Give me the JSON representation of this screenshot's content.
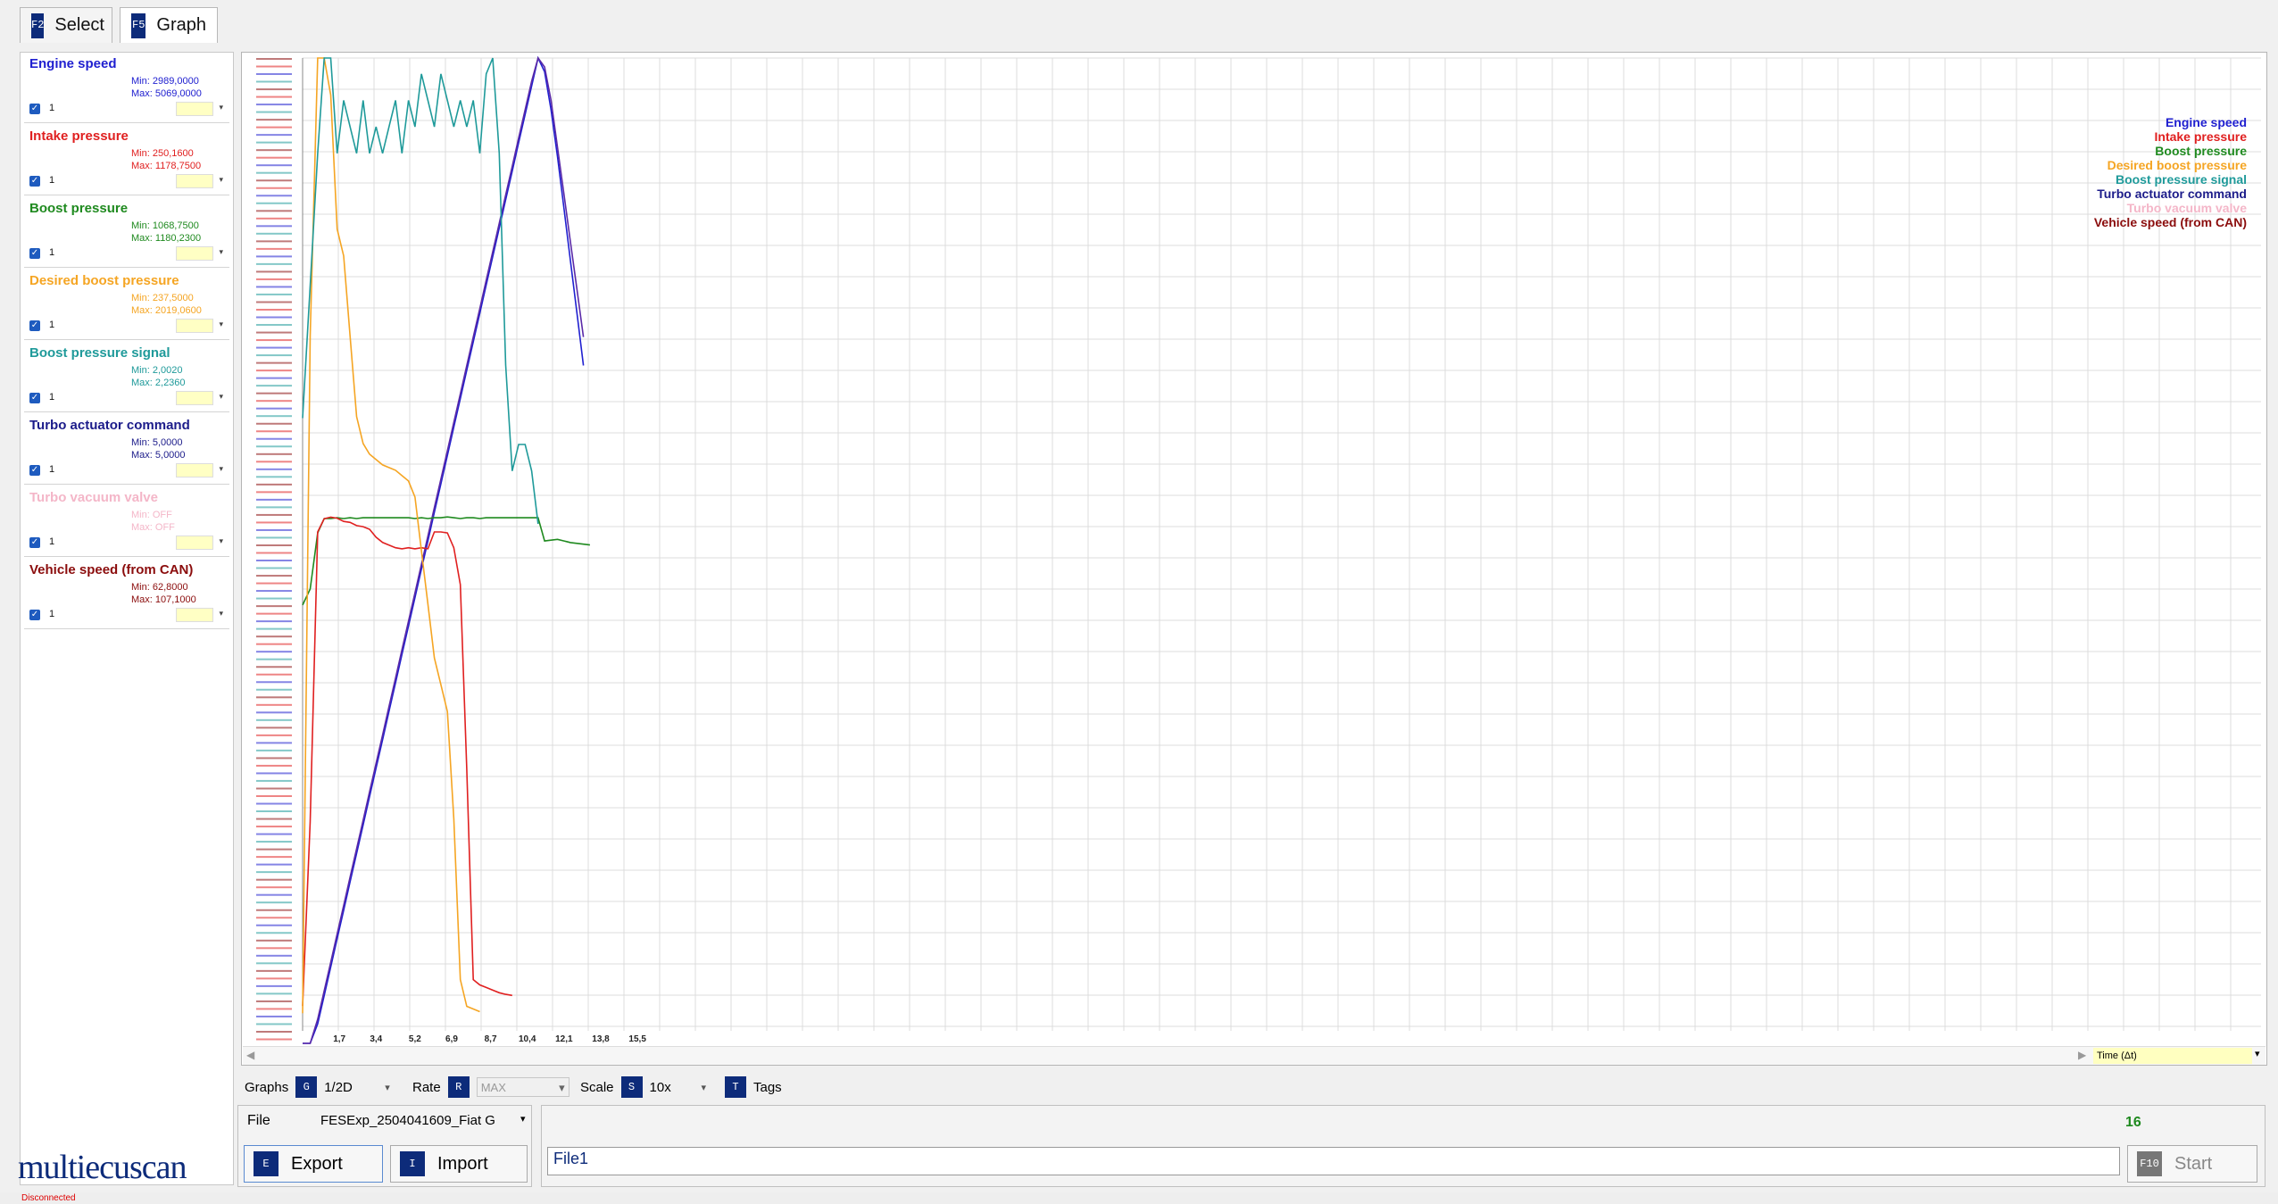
{
  "tabs": [
    {
      "key": "F2",
      "label": "Select",
      "active": false
    },
    {
      "key": "F5",
      "label": "Graph",
      "active": true
    }
  ],
  "params": [
    {
      "name": "Engine speed",
      "color": "#2020d0",
      "min": "Min: 2989,0000",
      "max": "Max: 5069,0000",
      "count": "1"
    },
    {
      "name": "Intake pressure",
      "color": "#e02020",
      "min": "Min: 250,1600",
      "max": "Max: 1178,7500",
      "count": "1"
    },
    {
      "name": "Boost pressure",
      "color": "#1f8a1f",
      "min": "Min: 1068,7500",
      "max": "Max: 1180,2300",
      "count": "1"
    },
    {
      "name": "Desired boost pressure",
      "color": "#f5a523",
      "min": "Min: 237,5000",
      "max": "Max: 2019,0600",
      "count": "1"
    },
    {
      "name": "Boost pressure signal",
      "color": "#1f9a9a",
      "min": "Min: 2,0020",
      "max": "Max: 2,2360",
      "count": "1"
    },
    {
      "name": "Turbo actuator command",
      "color": "#1c1c8a",
      "min": "Min: 5,0000",
      "max": "Max: 5,0000",
      "count": "1"
    },
    {
      "name": "Turbo vacuum valve",
      "color": "#f4b6c8",
      "min": "Min: OFF",
      "max": "Max: OFF",
      "count": "1"
    },
    {
      "name": "Vehicle speed (from CAN)",
      "color": "#8b0d0d",
      "min": "Min: 62,8000",
      "max": "Max: 107,1000",
      "count": "1"
    }
  ],
  "logo": "multiecuscan",
  "chart_data": {
    "type": "line",
    "x": [
      0,
      0.35,
      0.7,
      1.0,
      1.3,
      1.6,
      1.9,
      2.2,
      2.5,
      2.8,
      3.1,
      3.4,
      3.7,
      4.0,
      4.3,
      4.6,
      4.9,
      5.2,
      5.5,
      5.8,
      6.1,
      6.4,
      6.7,
      7.0,
      7.3,
      7.6,
      7.9,
      8.2,
      8.5,
      8.8,
      9.1,
      9.4,
      9.7,
      10.0,
      10.3,
      10.6,
      10.9,
      11.2,
      11.5,
      11.8,
      12.1,
      12.4,
      12.7,
      13.0,
      13.3,
      13.6,
      13.9,
      14.2,
      14.5,
      14.8,
      15.1,
      15.4,
      15.7
    ],
    "xticks": [
      "1,7",
      "3,4",
      "5,2",
      "6,9",
      "8,7",
      "10,4",
      "12,1",
      "13,8",
      "15,5"
    ],
    "xaxis_label": "Time (Δt)",
    "series": [
      {
        "name": "Engine speed",
        "color": "#2020d0",
        "values": [
          2989,
          2989,
          3030,
          3090,
          3150,
          3210,
          3270,
          3330,
          3390,
          3450,
          3510,
          3570,
          3630,
          3690,
          3750,
          3810,
          3870,
          3930,
          3990,
          4050,
          4110,
          4170,
          4230,
          4290,
          4350,
          4410,
          4470,
          4530,
          4590,
          4650,
          4710,
          4770,
          4830,
          4890,
          4950,
          5010,
          5069,
          5040,
          4960,
          4860,
          4750,
          4640,
          4530,
          4420
        ]
      },
      {
        "name": "Turbo actuator command",
        "color": "#5b2aa8",
        "values": [
          2989,
          2989,
          3040,
          3100,
          3160,
          3220,
          3280,
          3340,
          3400,
          3460,
          3520,
          3580,
          3640,
          3700,
          3760,
          3820,
          3880,
          3940,
          4000,
          4060,
          4120,
          4180,
          4240,
          4300,
          4360,
          4420,
          4480,
          4540,
          4600,
          4660,
          4720,
          4780,
          4840,
          4900,
          4960,
          5020,
          5069,
          5050,
          4980,
          4880,
          4780,
          4680,
          4580,
          4480
        ]
      },
      {
        "name": "Boost pressure",
        "color": "#1f8a1f",
        "values": [
          1070,
          1090,
          1160,
          1178,
          1178,
          1179,
          1178,
          1179,
          1178,
          1179,
          1179,
          1179,
          1179,
          1179,
          1179,
          1179,
          1179,
          1178,
          1179,
          1178,
          1179,
          1179,
          1180,
          1179,
          1178,
          1179,
          1179,
          1178,
          1179,
          1179,
          1179,
          1179,
          1179,
          1179,
          1179,
          1179,
          1179,
          1150,
          1151,
          1152,
          1150,
          1148,
          1147,
          1146,
          1145
        ]
      },
      {
        "name": "Intake pressure",
        "color": "#e02020",
        "values": [
          250,
          600,
          1150,
          1175,
          1178,
          1176,
          1170,
          1168,
          1162,
          1160,
          1155,
          1140,
          1130,
          1125,
          1120,
          1118,
          1120,
          1118,
          1120,
          1118,
          1150,
          1150,
          1148,
          1120,
          1050,
          700,
          300,
          290,
          285,
          280,
          275,
          272,
          270
        ]
      },
      {
        "name": "Desired boost pressure",
        "color": "#f5a523",
        "values": [
          237,
          1500,
          2019,
          2019,
          1950,
          1700,
          1650,
          1500,
          1350,
          1300,
          1280,
          1270,
          1260,
          1255,
          1250,
          1240,
          1230,
          1200,
          1100,
          1000,
          900,
          850,
          800,
          600,
          300,
          250,
          245,
          240
        ]
      },
      {
        "name": "Boost pressure signal",
        "color": "#1f9a9a",
        "values": [
          2.1,
          2.15,
          2.2,
          2.236,
          2.236,
          2.2,
          2.22,
          2.21,
          2.2,
          2.22,
          2.2,
          2.21,
          2.2,
          2.21,
          2.22,
          2.2,
          2.22,
          2.21,
          2.23,
          2.22,
          2.21,
          2.23,
          2.22,
          2.21,
          2.22,
          2.21,
          2.22,
          2.2,
          2.23,
          2.236,
          2.2,
          2.12,
          2.08,
          2.09,
          2.09,
          2.08,
          2.06
        ]
      }
    ],
    "legend_position": "top-right",
    "grid": true
  },
  "controls": {
    "graphs_label": "Graphs",
    "graphs_key": "G",
    "graphs_value": "1/2D",
    "rate_label": "Rate",
    "rate_key": "R",
    "rate_value": "MAX",
    "scale_label": "Scale",
    "scale_key": "S",
    "scale_value": "10x",
    "tags_key": "T",
    "tags_label": "Tags"
  },
  "file": {
    "label": "File",
    "value": "FESExp_2504041609_Fiat G",
    "export_key": "E",
    "export_label": "Export",
    "import_key": "I",
    "import_label": "Import"
  },
  "right": {
    "count": "16",
    "filename": "File1",
    "start_key": "F10",
    "start_label": "Start"
  },
  "status": "Disconnected"
}
